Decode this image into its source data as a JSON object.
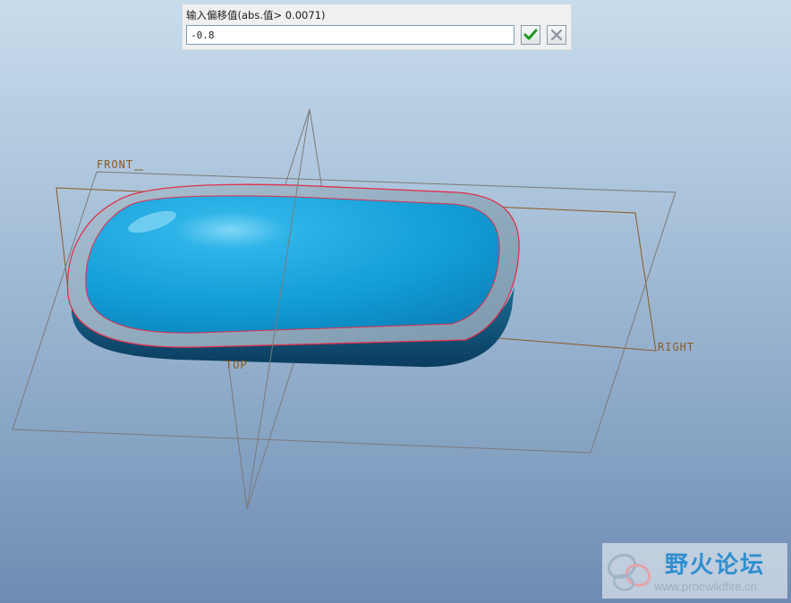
{
  "offset_dialog": {
    "prompt": "输入偏移值(abs.值> 0.0071)",
    "value": "-0.8",
    "ok_icon": "checkmark-icon",
    "cancel_icon": "close-icon"
  },
  "datum_planes": {
    "front_label": "FRONT",
    "top_label": "TOP",
    "right_label": "RIGHT"
  },
  "colors": {
    "part_surface": "#1aa7de",
    "part_side": "#0e4f78",
    "offset_rim": "#8aa9bf",
    "edge_highlight": "#e0304a",
    "datum_plane": "#8a5a20"
  },
  "watermark": {
    "title": "野火论坛",
    "url": "www.proewildfire.cn",
    "logo_icon": "butterfly-logo-icon"
  }
}
